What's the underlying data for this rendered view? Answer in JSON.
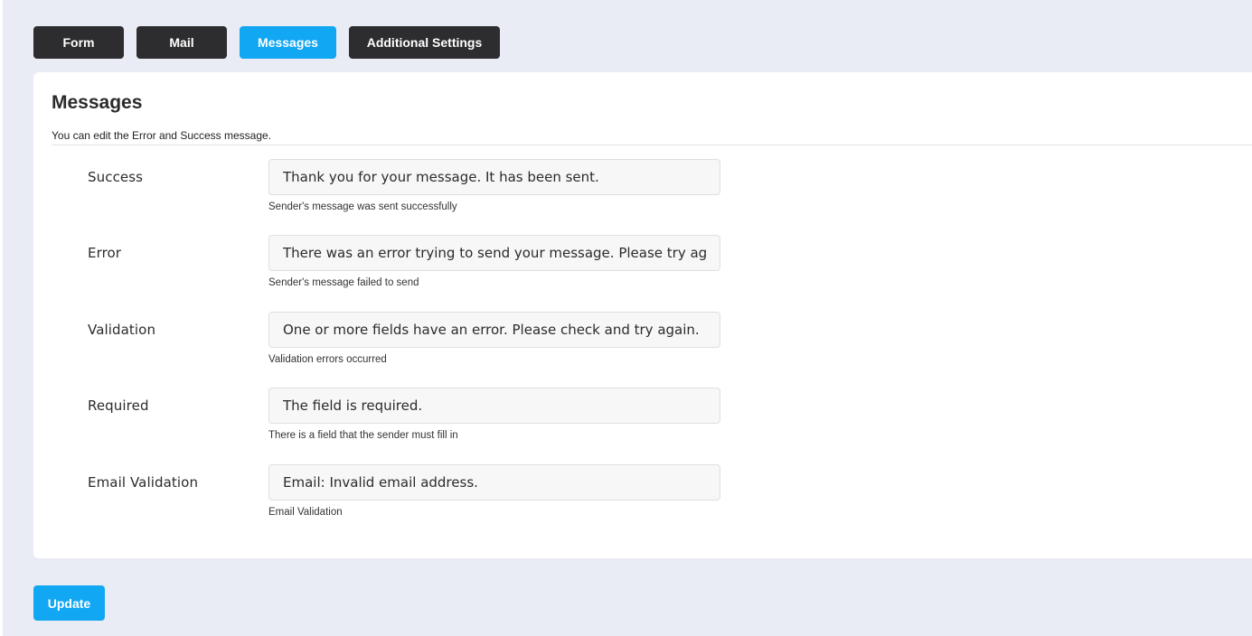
{
  "tabs": [
    {
      "label": "Form",
      "active": false
    },
    {
      "label": "Mail",
      "active": false
    },
    {
      "label": "Messages",
      "active": true
    },
    {
      "label": "Additional Settings",
      "active": false
    }
  ],
  "panel": {
    "title": "Messages",
    "description": "You can edit the Error and Success message."
  },
  "fields": [
    {
      "label": "Success",
      "value": "Thank you for your message. It has been sent.",
      "help": "Sender's message was sent successfully"
    },
    {
      "label": "Error",
      "value": "There was an error trying to send your message. Please try again later.",
      "help": "Sender's message failed to send"
    },
    {
      "label": "Validation",
      "value": "One or more fields have an error. Please check and try again.",
      "help": "Validation errors occurred"
    },
    {
      "label": "Required",
      "value": "The field is required.",
      "help": "There is a field that the sender must fill in"
    },
    {
      "label": "Email Validation",
      "value": "Email: Invalid email address.",
      "help": "Email Validation"
    }
  ],
  "actions": {
    "update_label": "Update"
  },
  "colors": {
    "accent": "#12a7f3",
    "tab_dark": "#2d2d2f",
    "page_background": "#e9ecf4"
  }
}
